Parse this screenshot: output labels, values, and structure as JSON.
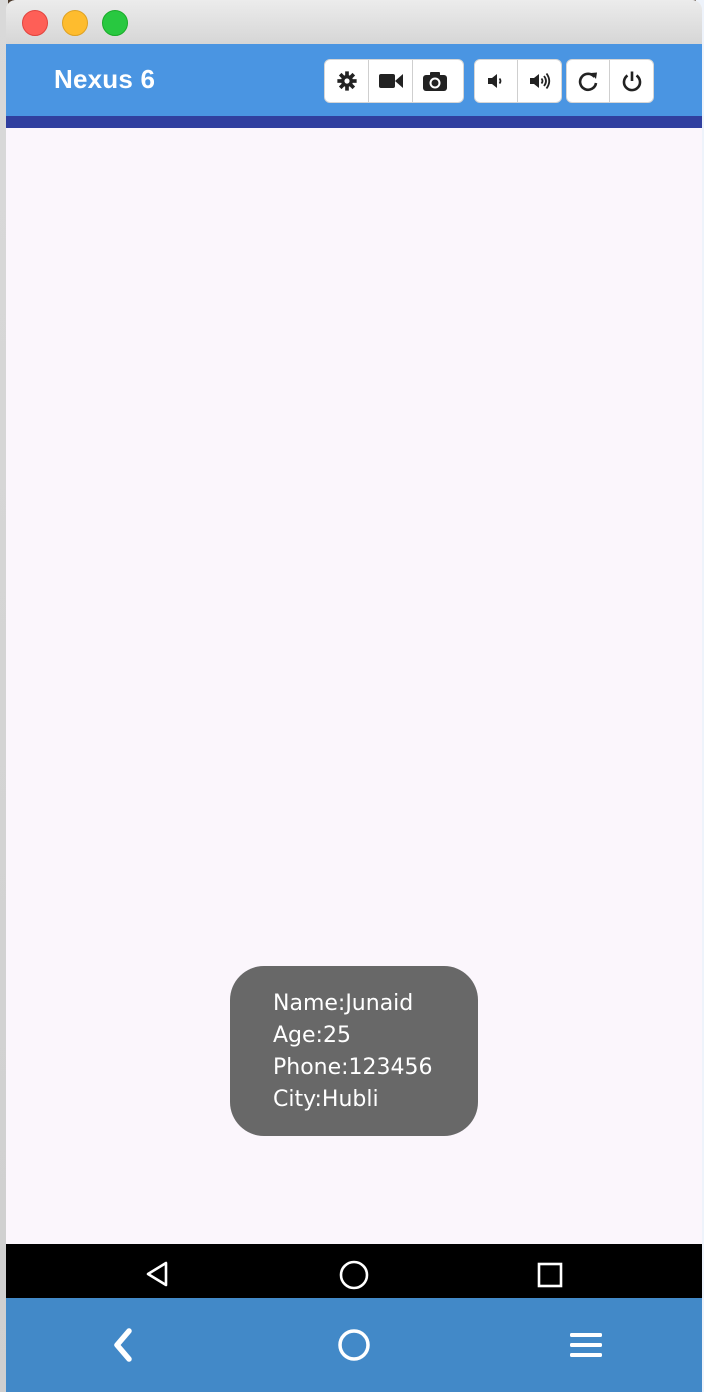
{
  "window": {
    "title": "",
    "controls": [
      "close",
      "minimize",
      "zoom"
    ]
  },
  "toolbar": {
    "device_name": "Nexus 6",
    "buttons": [
      {
        "icon": "gear-icon"
      },
      {
        "icon": "video-camera-icon"
      },
      {
        "icon": "camera-icon"
      },
      {
        "icon": "volume-down-icon"
      },
      {
        "icon": "volume-up-icon"
      },
      {
        "icon": "rotate-icon"
      },
      {
        "icon": "power-icon"
      }
    ]
  },
  "toast": {
    "lines": [
      "Name:Junaid",
      "Age:25",
      "Phone:123456",
      "City:Hubli"
    ]
  },
  "android_nav": [
    "back-triangle-icon",
    "home-circle-icon",
    "recents-square-icon"
  ],
  "footer_nav": [
    "back-chevron-icon",
    "home-ring-icon",
    "menu-icon"
  ],
  "colors": {
    "toolbar": "#4a95e2",
    "status_bar": "#303f9f",
    "screen": "#fbf6fc",
    "toast": "#686868",
    "footer": "#4289c8"
  }
}
